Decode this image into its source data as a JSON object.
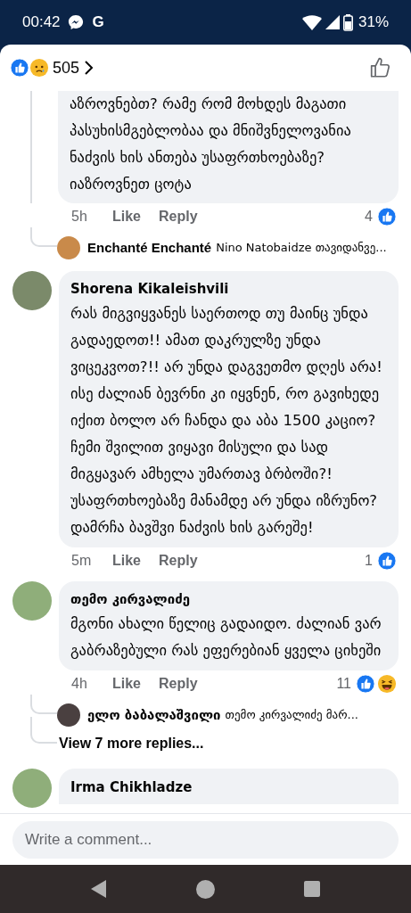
{
  "status_bar": {
    "time": "00:42",
    "app_letter": "G",
    "battery": "31%"
  },
  "header": {
    "reactions": [
      {
        "kind": "like"
      },
      {
        "kind": "sad"
      }
    ],
    "count": "505"
  },
  "comments": [
    {
      "kind": "cut",
      "text": "აზროვნებთ? რამე რომ მოხდეს მაგათი პასუხისმგებლობაა და მნიშვნელოვანია ნაძვის ხის  ანთება უსაფრთხოებაზე? იაზროვნეთ ცოტა",
      "time": "5h",
      "like": "Like",
      "reply": "Reply",
      "reaction_count": "4",
      "reactions": [
        {
          "kind": "like"
        }
      ],
      "reply_preview": {
        "author": "Enchanté Enchanté",
        "text": "Nino Natobaidze თავიდანვე..."
      }
    },
    {
      "kind": "full",
      "author": "Shorena Kikaleishvili",
      "text": "რას მიგვიყვანეს საერთოდ თუ მაინც უნდა გადაედოთ!! ამათ დაკრულზე უნდა ვიცეკვოთ?!! არ უნდა დაგვეთმო დღეს არა! ისე ძალიან ბევრნი კი იყვნენ, რო გავიხედე იქით ბოლო არ ჩანდა და აბა 1500 კაციო? ჩემი შვილით ვიყავი მისული და სად მიგყავარ ამხელა უმართავ ბრბოში?! უსაფრთხოებაზე მანამდე არ უნდა იზრუნო? დამრჩა ბავშვი ნაძვის ხის გარეშე!",
      "time": "5m",
      "like": "Like",
      "reply": "Reply",
      "reaction_count": "1",
      "reactions": [
        {
          "kind": "like"
        }
      ]
    },
    {
      "kind": "full",
      "author": "თემო კირვალიძე",
      "text": "მგონი ახალი წელიც გადაიდო. ძალიან ვარ გაბრაზებული რას ეფერებიან ყველა ციხეში",
      "time": "4h",
      "like": "Like",
      "reply": "Reply",
      "reaction_count": "11",
      "reactions": [
        {
          "kind": "like"
        },
        {
          "kind": "haha"
        }
      ],
      "reply_preview": {
        "author": "ელო ბაბალაშვილი",
        "text": "თემო კირვალიძე მარ..."
      },
      "more_replies": "View 7 more replies..."
    },
    {
      "kind": "name_only",
      "author": "Irma Chikhladze"
    }
  ],
  "composer": {
    "placeholder": "Write a comment..."
  }
}
